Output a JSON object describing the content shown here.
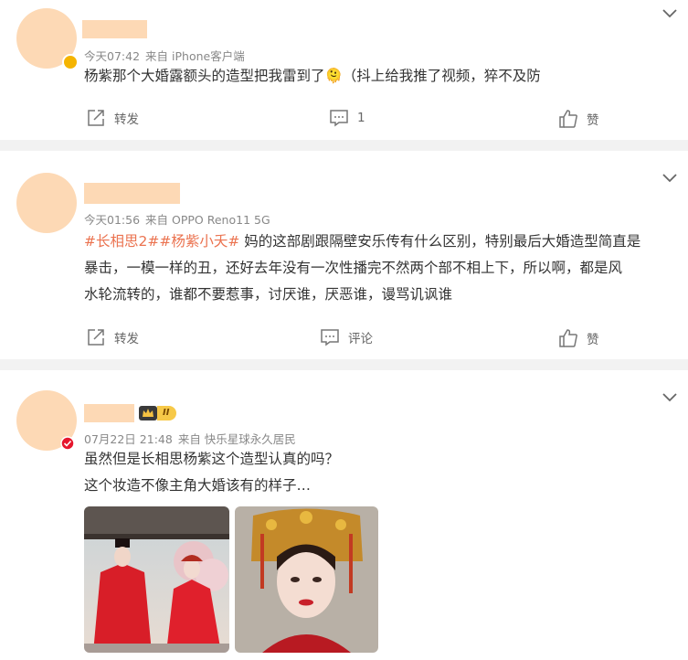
{
  "posts": [
    {
      "time": "今天07:42",
      "source": "来自 iPhone客户端",
      "text": "杨紫那个大婚露额头的造型把我雷到了🫠（抖上给我推了视频，猝不及防",
      "actions": {
        "repost": "转发",
        "comment_count": "1",
        "like": "赞"
      }
    },
    {
      "time": "今天01:56",
      "source": "来自 OPPO Reno11 5G",
      "tag": "#长相思2##杨紫小夭#",
      "line1": " 妈的这部剧跟隔壁安乐传有什么区别，特别最后大婚造型简直是",
      "line2": "暴击，一模一样的丑，还好去年没有一次性播完不然两个部不相上下，所以啊，都是风",
      "line3": "水轮流转的，谁都不要惹事，讨厌谁，厌恶谁，谩骂讥讽谁",
      "actions": {
        "repost": "转发",
        "comment": "评论",
        "like": "赞"
      }
    },
    {
      "time": "07月22日 21:48",
      "source": "来自 快乐星球永久居民",
      "line1": "虽然但是长相思杨紫这个造型认真的吗？",
      "line2": "这个妆造不像主角大婚该有的样子…",
      "vip_level": "II"
    }
  ],
  "colors": {
    "accent": "#eb7350",
    "avatar": "#fdd9b5",
    "separator": "#f2f2f2"
  }
}
